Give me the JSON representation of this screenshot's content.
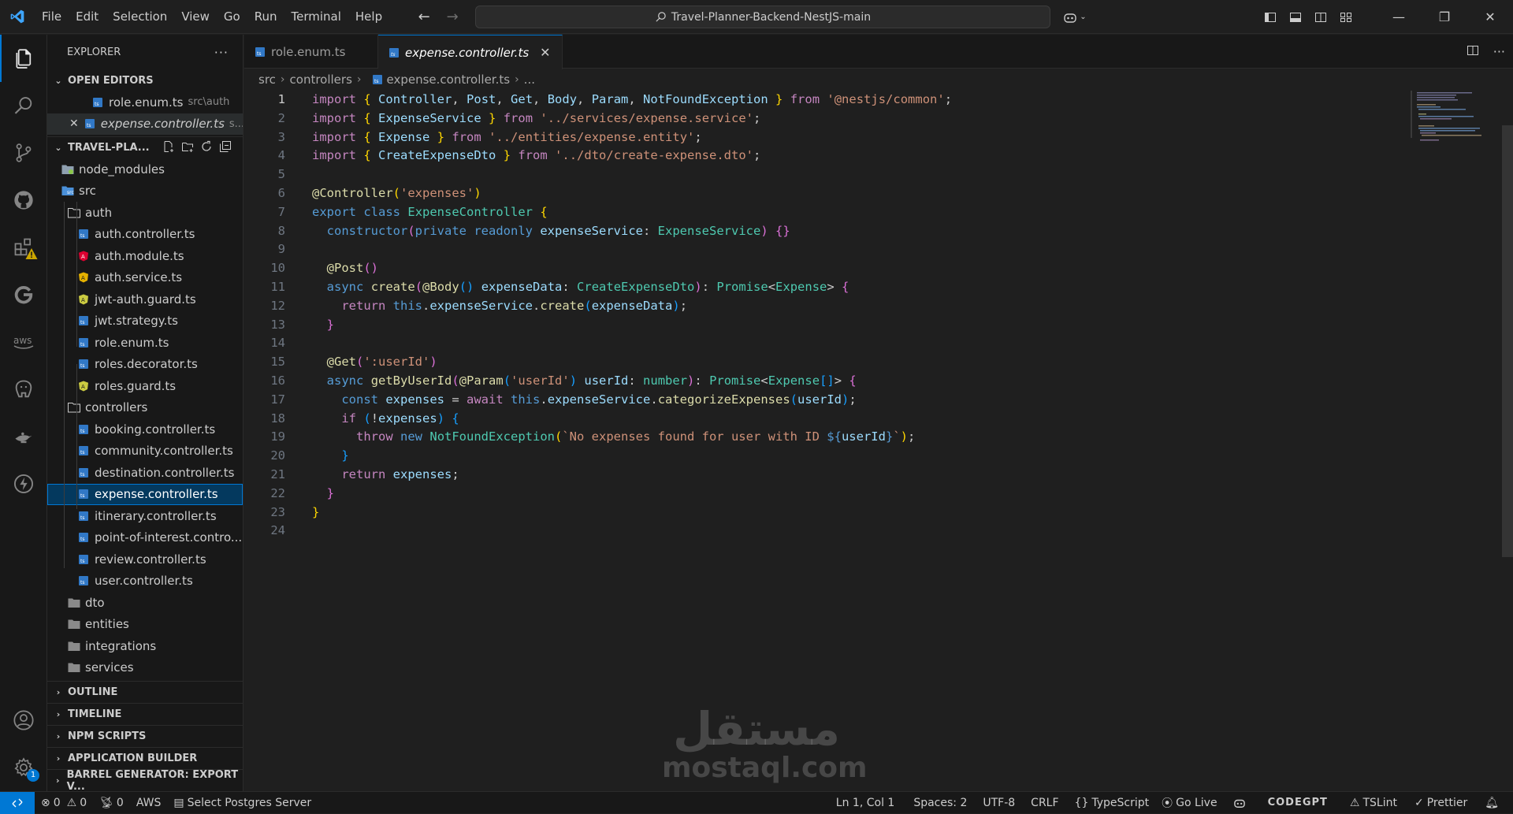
{
  "menu": [
    "File",
    "Edit",
    "Selection",
    "View",
    "Go",
    "Run",
    "Terminal",
    "Help"
  ],
  "command_center": "Travel-Planner-Backend-NestJS-main",
  "explorer": {
    "title": "EXPLORER",
    "open_editors_label": "OPEN EDITORS",
    "open_editors": [
      {
        "name": "role.enum.ts",
        "desc": "src\\auth"
      },
      {
        "name": "expense.controller.ts",
        "desc": "s..."
      }
    ],
    "project_label": "TRAVEL-PLA...",
    "tree": {
      "node_modules": "node_modules",
      "src": "src",
      "auth": "auth",
      "auth_files": [
        "auth.controller.ts",
        "auth.module.ts",
        "auth.service.ts",
        "jwt-auth.guard.ts",
        "jwt.strategy.ts",
        "role.enum.ts",
        "roles.decorator.ts",
        "roles.guard.ts"
      ],
      "controllers": "controllers",
      "controller_files": [
        "booking.controller.ts",
        "community.controller.ts",
        "destination.controller.ts",
        "expense.controller.ts",
        "itinerary.controller.ts",
        "point-of-interest.contro...",
        "review.controller.ts",
        "user.controller.ts"
      ],
      "folders": [
        "dto",
        "entities",
        "integrations",
        "services"
      ]
    },
    "sections": [
      "OUTLINE",
      "TIMELINE",
      "NPM SCRIPTS",
      "APPLICATION BUILDER",
      "BARREL GENERATOR: EXPORT V..."
    ]
  },
  "tabs": [
    {
      "label": "role.enum.ts",
      "active": false
    },
    {
      "label": "expense.controller.ts",
      "active": true
    }
  ],
  "breadcrumb": [
    "src",
    "controllers",
    "expense.controller.ts",
    "..."
  ],
  "status": {
    "errors": "0",
    "warnings": "0",
    "ports": "0",
    "aws": "AWS",
    "postgres": "Select Postgres Server",
    "position": "Ln 1, Col 1",
    "spaces": "Spaces: 2",
    "encoding": "UTF-8",
    "eol": "CRLF",
    "language": "TypeScript",
    "golive": "Go Live",
    "codegpt": "CODEGPT",
    "tslint": "TSLint",
    "prettier": "Prettier"
  },
  "watermark": {
    "arabic": "مستقل",
    "latin": "mostaql.com"
  },
  "colors": {
    "accent": "#0078d4",
    "bg": "#1f1f1f",
    "sidebar": "#181818",
    "ts_icon": "#3178c6",
    "angular_icon": "#dd0031",
    "guard_icon": "#cbcb41"
  }
}
